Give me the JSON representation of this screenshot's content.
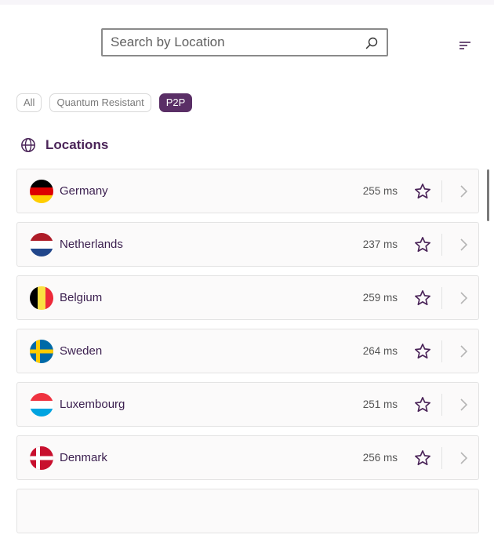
{
  "search": {
    "placeholder": "Search by Location",
    "value": ""
  },
  "filter_icon": "filter-lines-icon",
  "chips": [
    {
      "label": "All",
      "active": false
    },
    {
      "label": "Quantum Resistant",
      "active": false
    },
    {
      "label": "P2P",
      "active": true
    }
  ],
  "section": {
    "title": "Locations",
    "icon": "globe-icon"
  },
  "locations": [
    {
      "name": "Germany",
      "latency": "255 ms",
      "flag": "germany"
    },
    {
      "name": "Netherlands",
      "latency": "237 ms",
      "flag": "netherlands"
    },
    {
      "name": "Belgium",
      "latency": "259 ms",
      "flag": "belgium"
    },
    {
      "name": "Sweden",
      "latency": "264 ms",
      "flag": "sweden"
    },
    {
      "name": "Luxembourg",
      "latency": "251 ms",
      "flag": "luxembourg"
    },
    {
      "name": "Denmark",
      "latency": "256 ms",
      "flag": "denmark"
    }
  ],
  "colors": {
    "accent": "#5a2f66",
    "text": "#3b1f4f"
  }
}
